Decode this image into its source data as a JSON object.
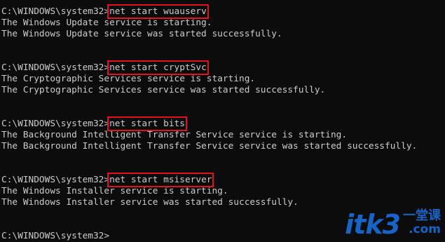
{
  "prompt": "C:\\WINDOWS\\system32>",
  "blocks": [
    {
      "command": "net start wuauserv",
      "output": [
        "The Windows Update service is starting.",
        "The Windows Update service was started successfully."
      ]
    },
    {
      "command": "net start cryptSvc",
      "output": [
        "The Cryptographic Services service is starting.",
        "The Cryptographic Services service was started successfully."
      ]
    },
    {
      "command": "net start bits",
      "output": [
        "The Background Intelligent Transfer Service service is starting.",
        "The Background Intelligent Transfer Service service was started successfully."
      ]
    },
    {
      "command": "net start msiserver",
      "output": [
        "The Windows Installer service is starting.",
        "The Windows Installer service was started successfully."
      ]
    }
  ],
  "watermark": {
    "main": "itk3",
    "chinese": "一堂课",
    "domain": ".com"
  },
  "colors": {
    "background": "#0c0c0c",
    "text": "#cccccc",
    "highlight_box": "#e0151b",
    "watermark": "#1a6fe0"
  }
}
